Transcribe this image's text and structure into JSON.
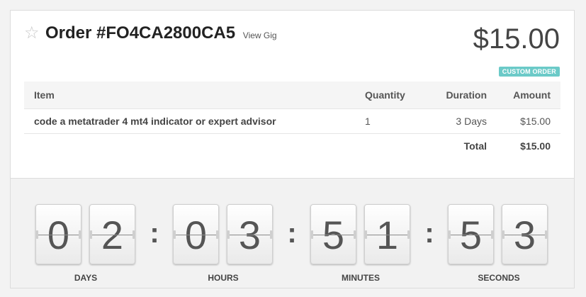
{
  "order": {
    "title": "Order #FO4CA2800CA5",
    "view_gig_label": "View Gig",
    "price": "$15.00",
    "badge": "CUSTOM ORDER"
  },
  "table": {
    "headers": {
      "item": "Item",
      "quantity": "Quantity",
      "duration": "Duration",
      "amount": "Amount"
    },
    "rows": [
      {
        "item": "code a metatrader 4 mt4 indicator or expert advisor",
        "quantity": "1",
        "duration": "3 Days",
        "amount": "$15.00"
      }
    ],
    "total_label": "Total",
    "total_value": "$15.00"
  },
  "countdown": {
    "days": [
      "0",
      "2"
    ],
    "hours": [
      "0",
      "3"
    ],
    "minutes": [
      "5",
      "1"
    ],
    "seconds": [
      "5",
      "3"
    ],
    "colon": ":",
    "labels": {
      "days": "DAYS",
      "hours": "HOURS",
      "minutes": "MINUTES",
      "seconds": "SECONDS"
    }
  },
  "icons": {
    "favorite": "star-outline-icon"
  }
}
